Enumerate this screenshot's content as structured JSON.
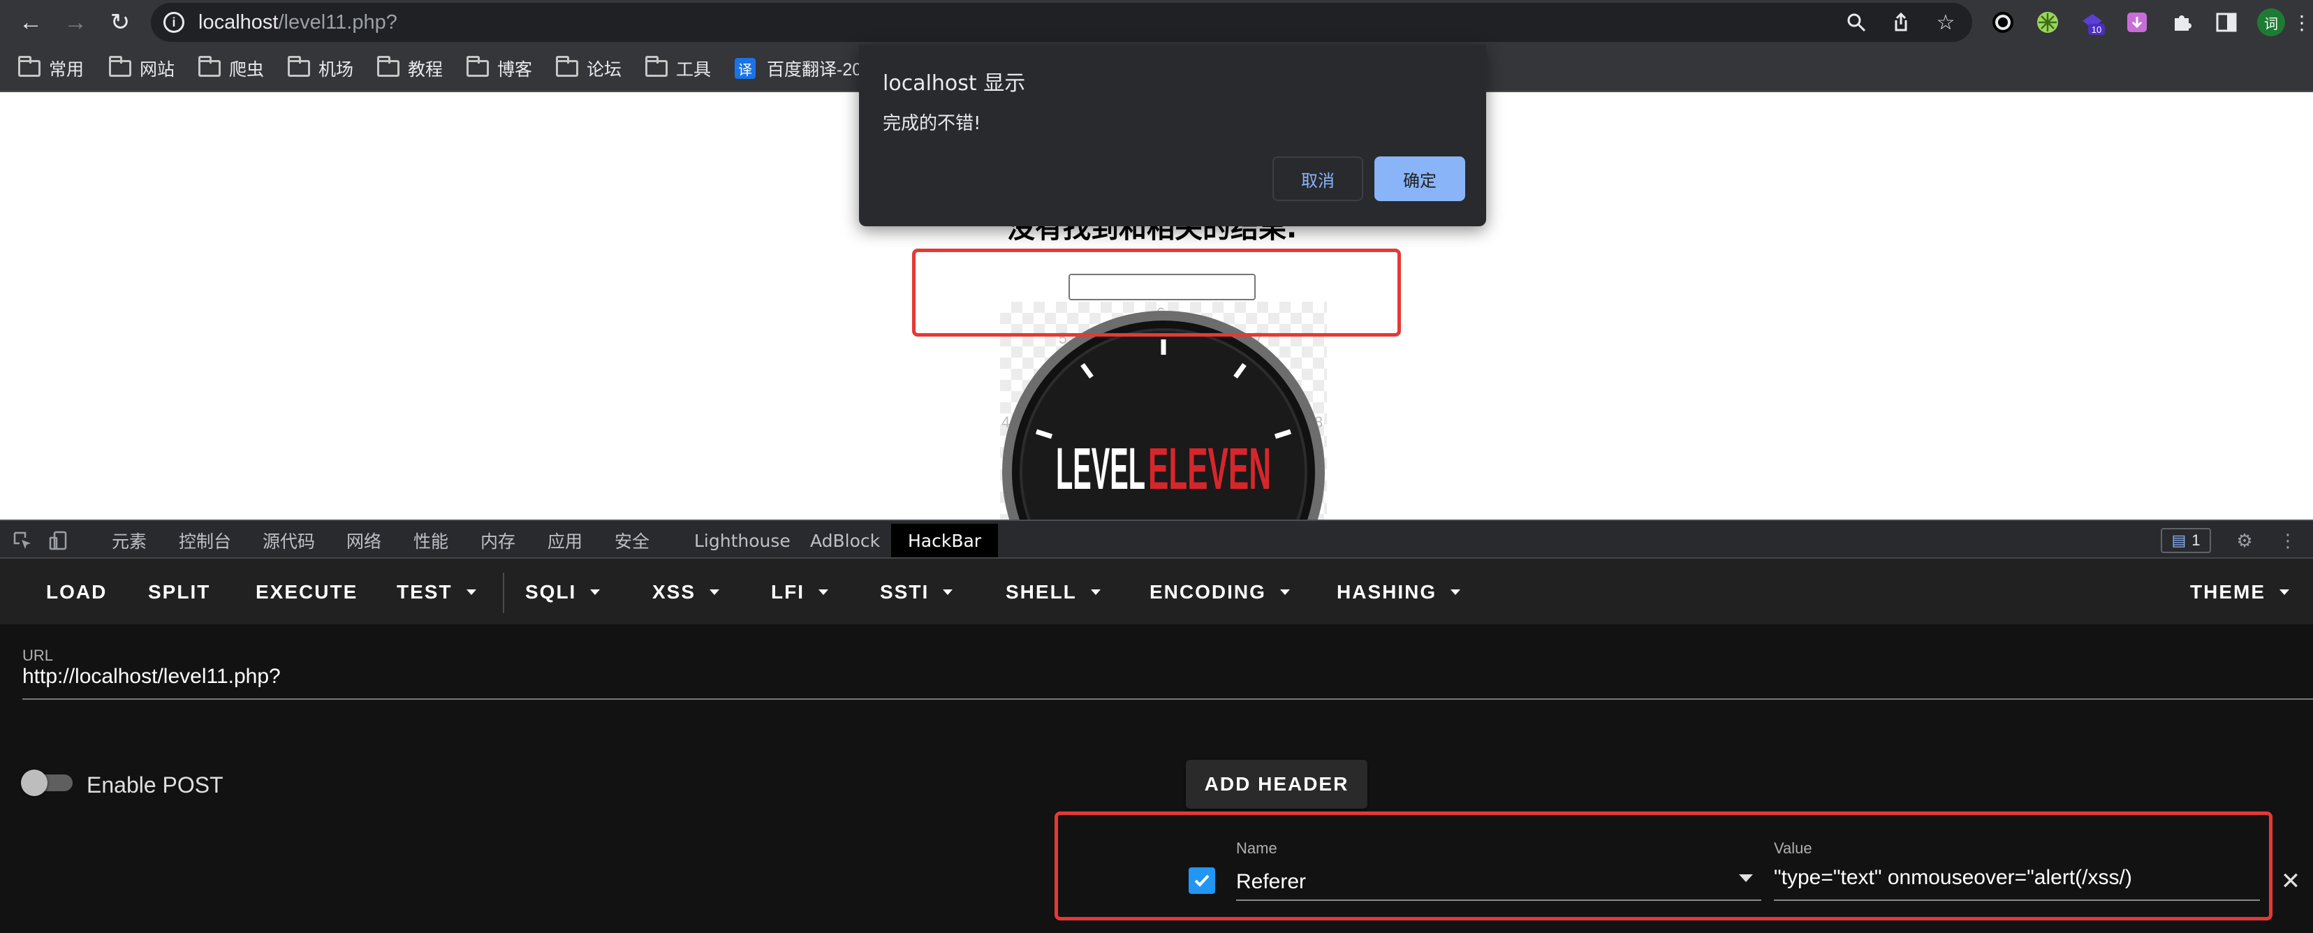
{
  "browser": {
    "url_host": "localhost",
    "url_path": "/level11.php?",
    "bookmarks": [
      {
        "label": "常用",
        "icon": "folder-icon"
      },
      {
        "label": "网站",
        "icon": "folder-icon"
      },
      {
        "label": "爬虫",
        "icon": "folder-icon"
      },
      {
        "label": "机场",
        "icon": "folder-icon"
      },
      {
        "label": "教程",
        "icon": "folder-icon"
      },
      {
        "label": "博客",
        "icon": "folder-icon"
      },
      {
        "label": "论坛",
        "icon": "folder-icon"
      },
      {
        "label": "工具",
        "icon": "folder-icon"
      },
      {
        "label": "百度翻译-20",
        "icon": "translate-icon",
        "badge": "译"
      }
    ],
    "extension_badge": "10",
    "avatar_text": "词"
  },
  "page": {
    "heading": "没有找到和相关的结果.",
    "logo": {
      "part1": "LEVEL",
      "part2": "ELEVEN"
    }
  },
  "dialog": {
    "title": "localhost 显示",
    "message": "完成的不错!",
    "cancel_label": "取消",
    "ok_label": "确定"
  },
  "devtools": {
    "tabs": [
      "元素",
      "控制台",
      "源代码",
      "网络",
      "性能",
      "内存",
      "应用",
      "安全",
      "Lighthouse",
      "AdBlock",
      "HackBar"
    ],
    "active_tab": "HackBar",
    "issues_count": "1"
  },
  "hackbar": {
    "menu": [
      {
        "label": "LOAD",
        "dropdown": false
      },
      {
        "label": "SPLIT",
        "dropdown": false
      },
      {
        "label": "EXECUTE",
        "dropdown": false
      },
      {
        "label": "TEST",
        "dropdown": true
      },
      {
        "label": "SQLI",
        "dropdown": true
      },
      {
        "label": "XSS",
        "dropdown": true
      },
      {
        "label": "LFI",
        "dropdown": true
      },
      {
        "label": "SSTI",
        "dropdown": true
      },
      {
        "label": "SHELL",
        "dropdown": true
      },
      {
        "label": "ENCODING",
        "dropdown": true
      },
      {
        "label": "HASHING",
        "dropdown": true
      },
      {
        "label": "THEME",
        "dropdown": true
      }
    ],
    "url_label": "URL",
    "url_value": "http://localhost/level11.php?",
    "enable_post_label": "Enable POST",
    "add_header_label": "ADD HEADER",
    "header": {
      "enabled": true,
      "name_label": "Name",
      "name_value": "Referer",
      "value_label": "Value",
      "value_value": "\"type=\"text\" onmouseover=\"alert(/xss/)"
    }
  },
  "colors": {
    "highlight": "#e53935",
    "dialog_ok": "#8ab4f8",
    "checkbox": "#2196f3"
  }
}
